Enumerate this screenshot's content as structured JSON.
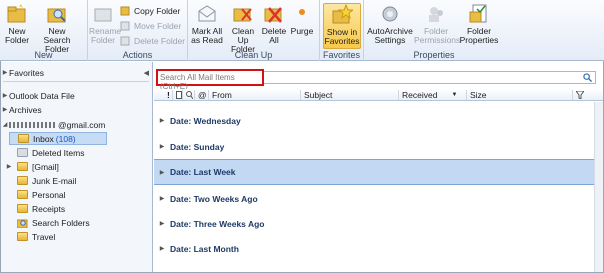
{
  "ribbon": {
    "groups": {
      "new": "New",
      "actions": "Actions",
      "cleanup": "Clean Up",
      "favorites": "Favorites",
      "properties": "Properties"
    },
    "buttons": {
      "new_folder": "New Folder",
      "new_search_folder": "New Search Folder",
      "rename_folder": "Rename Folder",
      "copy_folder": "Copy Folder",
      "move_folder": "Move Folder",
      "delete_folder": "Delete Folder",
      "mark_all_as_read": "Mark All as Read",
      "clean_up_folder": "Clean Up Folder",
      "delete_all": "Delete All",
      "purge": "Purge",
      "show_in_favorites": "Show in Favorites",
      "autoarchive_settings": "AutoArchive Settings",
      "folder_permissions": "Folder Permissions",
      "folder_properties": "Folder Properties"
    }
  },
  "nav": {
    "favorites": "Favorites",
    "outlook_data_file": "Outlook Data File",
    "archives": "Archives",
    "account": "@gmail.com",
    "inbox": "Inbox",
    "inbox_count": "(108)",
    "deleted_items": "Deleted Items",
    "gmail": "[Gmail]",
    "junk": "Junk E-mail",
    "personal": "Personal",
    "receipts": "Receipts",
    "search_folders": "Search Folders",
    "travel": "Travel"
  },
  "search": {
    "placeholder": "Search All Mail Items (Ctrl+E)"
  },
  "columns": {
    "from": "From",
    "subject": "Subject",
    "received": "Received",
    "size": "Size"
  },
  "groups": [
    "Date: Wednesday",
    "Date: Sunday",
    "Date: Last Week",
    "Date: Two Weeks Ago",
    "Date: Three Weeks Ago",
    "Date: Last Month"
  ],
  "colors": {
    "accent": "#c3d9f3",
    "search_highlight": "#d01212",
    "active_button": "#f8c94a"
  }
}
